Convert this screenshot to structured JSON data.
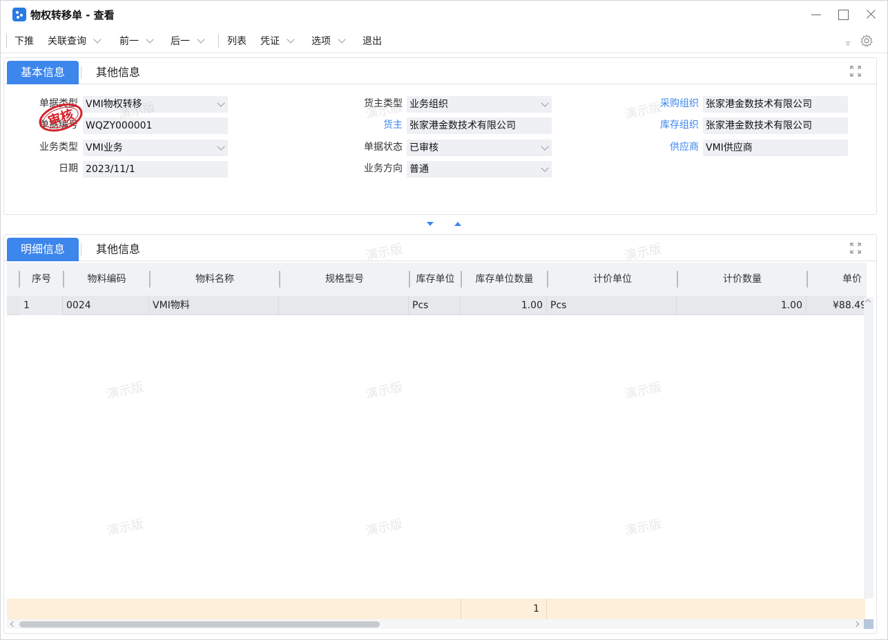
{
  "window": {
    "title": "物权转移单 - 查看"
  },
  "toolbar": {
    "items": [
      {
        "label": "下推",
        "dropdown": false
      },
      {
        "label": "关联查询",
        "dropdown": true
      },
      {
        "label": "前一",
        "dropdown": true
      },
      {
        "label": "后一",
        "dropdown": true
      },
      {
        "label": "列表",
        "dropdown": false
      },
      {
        "label": "凭证",
        "dropdown": true
      },
      {
        "label": "选项",
        "dropdown": true
      },
      {
        "label": "退出",
        "dropdown": false
      }
    ]
  },
  "basic_panel": {
    "tabs": [
      "基本信息",
      "其他信息"
    ],
    "stamp": "审核",
    "fields": {
      "bill_type": {
        "label": "单据类型",
        "value": "VMI物权转移"
      },
      "bill_no": {
        "label": "单据编号",
        "value": "WQZY000001"
      },
      "biz_type": {
        "label": "业务类型",
        "value": "VMI业务"
      },
      "date": {
        "label": "日期",
        "value": "2023/11/1"
      },
      "owner_type": {
        "label": "货主类型",
        "value": "业务组织"
      },
      "owner": {
        "label": "货主",
        "value": "张家港金数技术有限公司"
      },
      "bill_status": {
        "label": "单据状态",
        "value": "已审核"
      },
      "biz_direction": {
        "label": "业务方向",
        "value": "普通"
      },
      "purchase_org": {
        "label": "采购组织",
        "value": "张家港金数技术有限公司"
      },
      "stock_org": {
        "label": "库存组织",
        "value": "张家港金数技术有限公司"
      },
      "supplier": {
        "label": "供应商",
        "value": "VMI供应商"
      }
    }
  },
  "detail_panel": {
    "tabs": [
      "明细信息",
      "其他信息"
    ],
    "columns": [
      "序号",
      "物料编码",
      "物料名称",
      "规格型号",
      "库存单位",
      "库存单位数量",
      "计价单位",
      "计价数量",
      "单价"
    ],
    "rows": [
      {
        "seq": "1",
        "material_code": "0024",
        "material_name": "VMI物料",
        "spec": "",
        "stock_unit": "Pcs",
        "stock_qty": "1.00",
        "price_unit": "Pcs",
        "price_qty": "1.00",
        "unit_price": "¥88.49"
      }
    ],
    "total": {
      "stock_qty": "1"
    }
  },
  "watermark": "演示版",
  "colors": {
    "accent": "#3c86ec",
    "stamp": "#d4222a",
    "total_row": "#fdefd9"
  }
}
